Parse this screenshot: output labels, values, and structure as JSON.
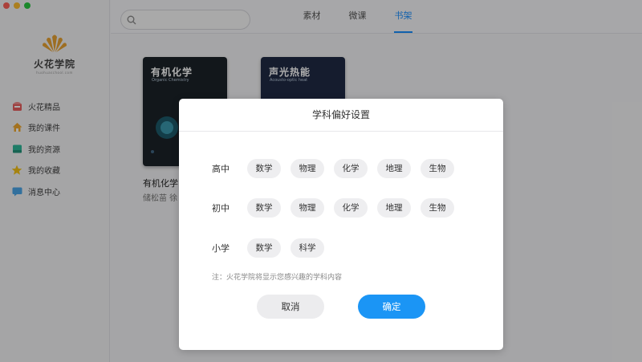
{
  "app": {
    "logo_name": "火花学院",
    "logo_sub": "huohuaschool.com",
    "brand_color": "#e8a233"
  },
  "sidebar": {
    "items": [
      {
        "label": "火花精品",
        "icon": "store-icon"
      },
      {
        "label": "我的课件",
        "icon": "home-icon"
      },
      {
        "label": "我的资源",
        "icon": "folder-icon"
      },
      {
        "label": "我的收藏",
        "icon": "star-icon"
      },
      {
        "label": "消息中心",
        "icon": "message-icon"
      }
    ]
  },
  "topbar": {
    "search_placeholder": "",
    "tabs": [
      {
        "label": "素材",
        "active": false
      },
      {
        "label": "微课",
        "active": false
      },
      {
        "label": "书架",
        "active": true
      }
    ]
  },
  "shelf": {
    "books": [
      {
        "cover_title": "有机化学",
        "cover_sub": "Organic Chemistry",
        "label": "有机化学",
        "authors": "储松苗 徐"
      },
      {
        "cover_title": "声光热能",
        "cover_sub": "Acousto-optic heat",
        "label": "",
        "authors": ""
      }
    ]
  },
  "modal": {
    "title": "学科偏好设置",
    "groups": [
      {
        "label": "高中",
        "subjects": [
          "数学",
          "物理",
          "化学",
          "地理",
          "生物"
        ]
      },
      {
        "label": "初中",
        "subjects": [
          "数学",
          "物理",
          "化学",
          "地理",
          "生物"
        ]
      },
      {
        "label": "小学",
        "subjects": [
          "数学",
          "科学"
        ]
      }
    ],
    "note": "注：火花学院将显示您感兴趣的学科内容",
    "cancel_label": "取消",
    "confirm_label": "确定"
  },
  "colors": {
    "accent": "#1b95f5",
    "tab_active": "#1a8fff"
  }
}
